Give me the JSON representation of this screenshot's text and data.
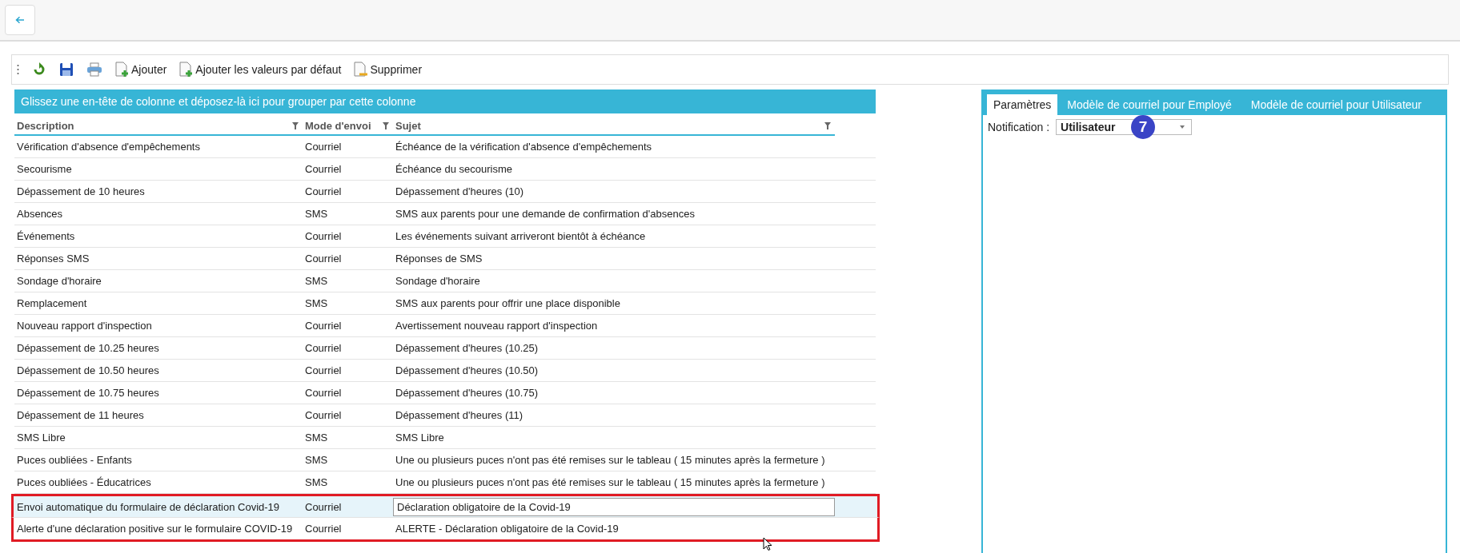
{
  "toolbar": {
    "buttons": [
      {
        "kind": "refresh"
      },
      {
        "kind": "save"
      },
      {
        "kind": "print"
      },
      {
        "kind": "add",
        "label": "Ajouter"
      },
      {
        "kind": "add",
        "label": "Ajouter les valeurs par défaut"
      },
      {
        "kind": "delete",
        "label": "Supprimer"
      }
    ]
  },
  "grid": {
    "group_panel": "Glissez une en-tête de colonne et déposez-là ici pour grouper par cette colonne",
    "columns": [
      "Description",
      "Mode d'envoi",
      "Sujet"
    ],
    "rows": [
      {
        "cells": [
          "Vérification d'absence d'empêchements",
          "Courriel",
          "Échéance de la vérification d'absence d'empêchements"
        ],
        "selected": false,
        "highlighted": false
      },
      {
        "cells": [
          "Secourisme",
          "Courriel",
          "Échéance du secourisme"
        ],
        "selected": false,
        "highlighted": false
      },
      {
        "cells": [
          "Dépassement de 10 heures",
          "Courriel",
          "Dépassement d'heures (10)"
        ],
        "selected": false,
        "highlighted": false
      },
      {
        "cells": [
          "Absences",
          "SMS",
          "SMS aux parents pour une demande de confirmation d'absences"
        ],
        "selected": false,
        "highlighted": false
      },
      {
        "cells": [
          "Événements",
          "Courriel",
          "Les événements suivant arriveront bientôt à échéance"
        ],
        "selected": false,
        "highlighted": false
      },
      {
        "cells": [
          "Réponses SMS",
          "Courriel",
          "Réponses de SMS"
        ],
        "selected": false,
        "highlighted": false
      },
      {
        "cells": [
          "Sondage d'horaire",
          "SMS",
          "Sondage d'horaire"
        ],
        "selected": false,
        "highlighted": false
      },
      {
        "cells": [
          "Remplacement",
          "SMS",
          "SMS aux parents pour offrir une place disponible"
        ],
        "selected": false,
        "highlighted": false
      },
      {
        "cells": [
          "Nouveau rapport d'inspection",
          "Courriel",
          "Avertissement nouveau rapport d'inspection"
        ],
        "selected": false,
        "highlighted": false
      },
      {
        "cells": [
          "Dépassement de 10.25 heures",
          "Courriel",
          "Dépassement d'heures (10.25)"
        ],
        "selected": false,
        "highlighted": false
      },
      {
        "cells": [
          "Dépassement de 10.50 heures",
          "Courriel",
          "Dépassement d'heures (10.50)"
        ],
        "selected": false,
        "highlighted": false
      },
      {
        "cells": [
          "Dépassement de 10.75 heures",
          "Courriel",
          "Dépassement d'heures (10.75)"
        ],
        "selected": false,
        "highlighted": false
      },
      {
        "cells": [
          "Dépassement de 11 heures",
          "Courriel",
          "Dépassement d'heures (11)"
        ],
        "selected": false,
        "highlighted": false
      },
      {
        "cells": [
          "SMS Libre",
          "SMS",
          "SMS Libre"
        ],
        "selected": false,
        "highlighted": false
      },
      {
        "cells": [
          "Puces oubliées - Enfants",
          "SMS",
          "Une ou plusieurs puces n'ont pas été remises sur le tableau ( 15 minutes après la fermeture )"
        ],
        "selected": false,
        "highlighted": false
      },
      {
        "cells": [
          "Puces oubliées - Éducatrices",
          "SMS",
          "Une ou plusieurs puces n'ont pas été remises sur le tableau ( 15 minutes après la fermeture )"
        ],
        "selected": false,
        "highlighted": false
      },
      {
        "cells": [
          "Envoi automatique du formulaire de déclaration Covid-19",
          "Courriel",
          "Déclaration obligatoire de la Covid-19"
        ],
        "selected": true,
        "highlighted": true
      },
      {
        "cells": [
          "Alerte d'une déclaration positive sur le formulaire COVID-19",
          "Courriel",
          "ALERTE - Déclaration obligatoire de la Covid-19"
        ],
        "selected": false,
        "highlighted": true
      }
    ]
  },
  "panel": {
    "tabs": [
      {
        "label": "Paramètres",
        "selected": true
      },
      {
        "label": "Modèle de courriel pour Employé",
        "selected": false
      },
      {
        "label": "Modèle de courriel pour Utilisateur",
        "selected": false
      }
    ],
    "notification": {
      "label": "Notification :",
      "value": "Utilisateur"
    },
    "step_badge": "7"
  }
}
